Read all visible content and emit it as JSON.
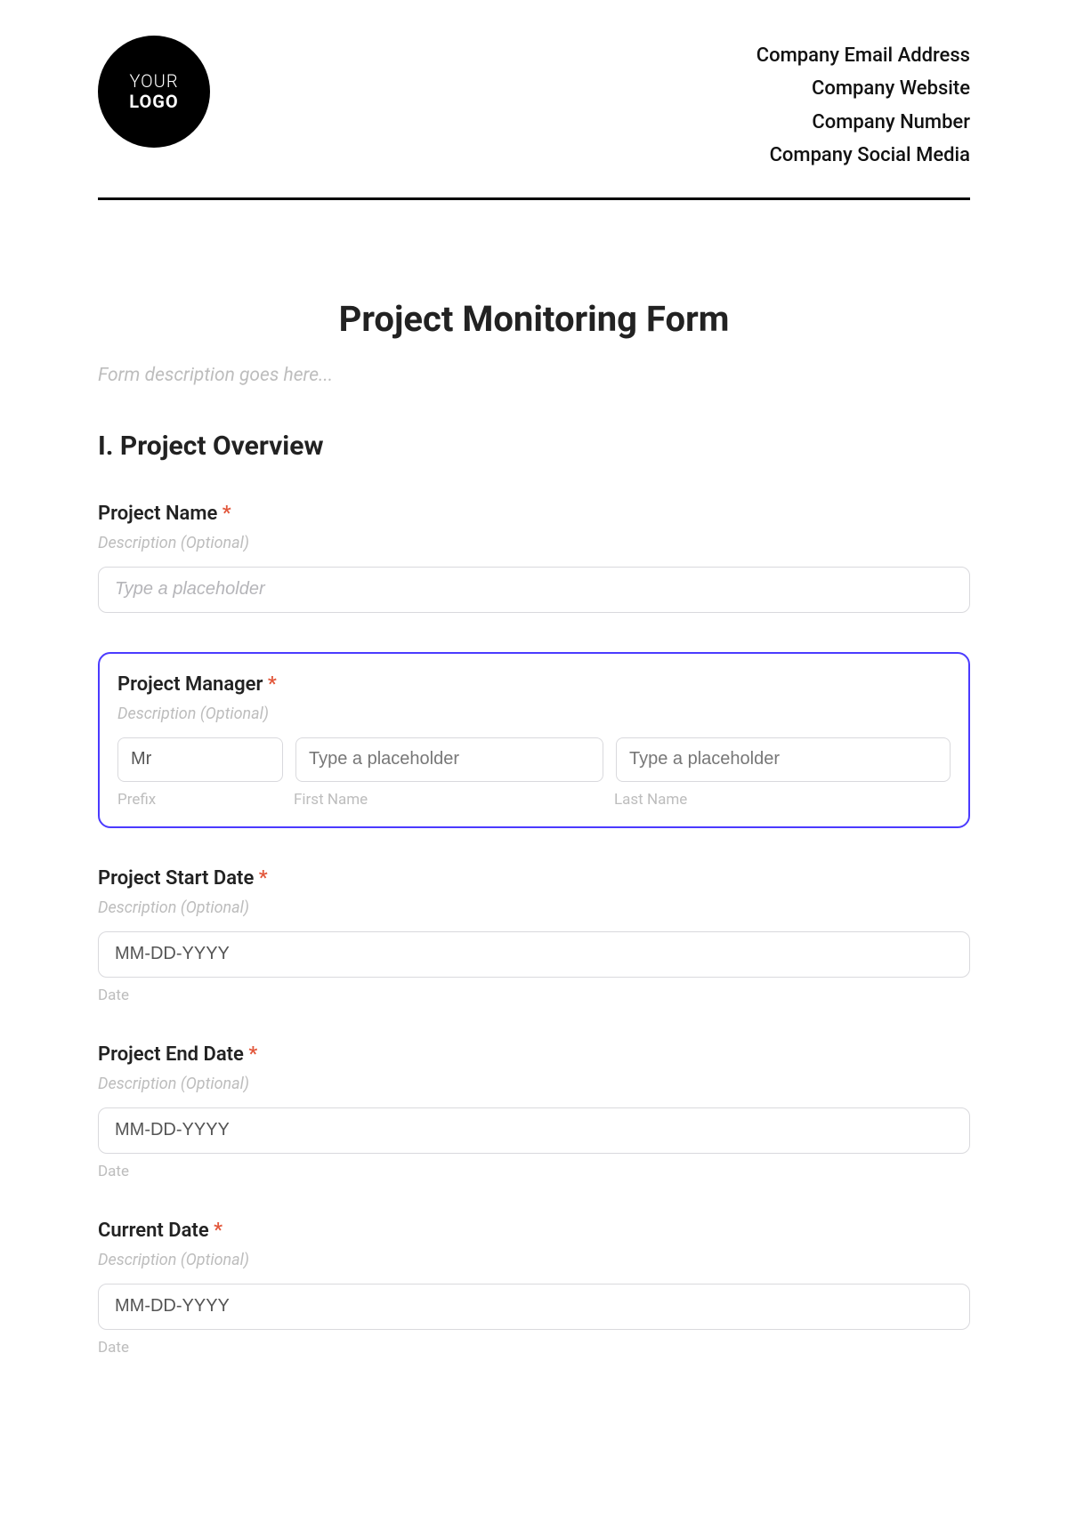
{
  "header": {
    "logo_line1": "YOUR",
    "logo_line2": "LOGO",
    "company_lines": [
      "Company Email Address",
      "Company Website",
      "Company Number",
      "Company Social Media"
    ]
  },
  "title": "Project Monitoring Form",
  "form_description_placeholder": "Form description goes here...",
  "section1_heading": "I. Project Overview",
  "fields": {
    "project_name": {
      "label": "Project Name",
      "required_mark": "*",
      "desc": "Description (Optional)",
      "placeholder": "Type a placeholder"
    },
    "project_manager": {
      "label": "Project Manager",
      "required_mark": "*",
      "desc": "Description (Optional)",
      "prefix_value": "Mr",
      "first_placeholder": "Type a placeholder",
      "last_placeholder": "Type a placeholder",
      "cap_prefix": "Prefix",
      "cap_first": "First Name",
      "cap_last": "Last Name"
    },
    "start_date": {
      "label": "Project Start Date",
      "required_mark": "*",
      "desc": "Description (Optional)",
      "placeholder": "MM-DD-YYYY",
      "caption": "Date"
    },
    "end_date": {
      "label": "Project End Date",
      "required_mark": "*",
      "desc": "Description (Optional)",
      "placeholder": "MM-DD-YYYY",
      "caption": "Date"
    },
    "current_date": {
      "label": "Current Date",
      "required_mark": "*",
      "desc": "Description (Optional)",
      "placeholder": "MM-DD-YYYY",
      "caption": "Date"
    }
  }
}
